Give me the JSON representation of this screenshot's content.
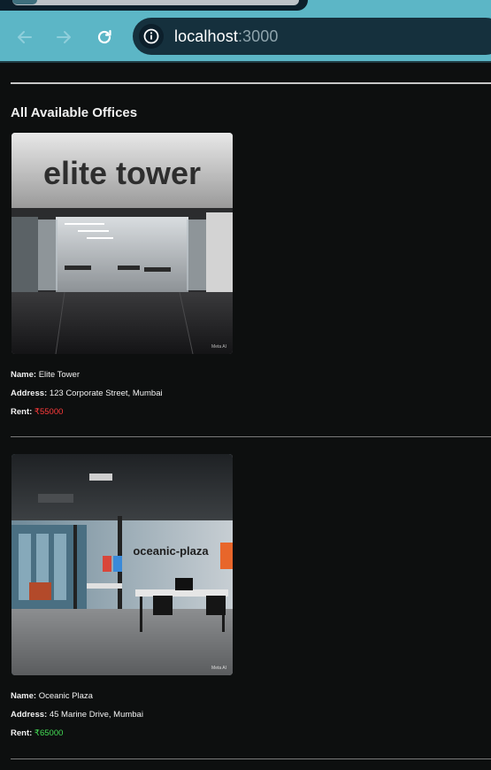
{
  "browser": {
    "url_host": "localhost",
    "url_port": ":3000"
  },
  "page": {
    "heading": "All Available Offices"
  },
  "offices": [
    {
      "sign": "elite tower",
      "name_label": "Name:",
      "name": "Elite Tower",
      "address_label": "Address:",
      "address": "123 Corporate Street, Mumbai",
      "rent_label": "Rent:",
      "rent": "₹55000",
      "rent_color": "#ff3b3b",
      "watermark": "Meta AI"
    },
    {
      "sign": "oceanic-plaza",
      "name_label": "Name:",
      "name": "Oceanic Plaza",
      "address_label": "Address:",
      "address": "45 Marine Drive, Mumbai",
      "rent_label": "Rent:",
      "rent": "₹65000",
      "rent_color": "#44dd55",
      "watermark": "Meta AI"
    }
  ]
}
